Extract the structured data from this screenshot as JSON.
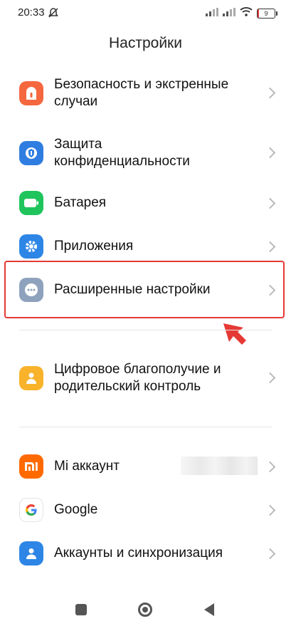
{
  "status": {
    "time": "20:33",
    "battery_level": "9",
    "battery_fraction": 0.09
  },
  "header": {
    "title": "Настройки"
  },
  "items": [
    {
      "label_lines": [
        "Безопасность и экстренные",
        "случаи"
      ],
      "icon": "shield-icon",
      "color": "#f5683f"
    },
    {
      "label_lines": [
        "Защита",
        "конфиденциальности"
      ],
      "icon": "privacy-icon",
      "color": "#2f7de0"
    },
    {
      "label_lines": [
        "Батарея"
      ],
      "icon": "battery-icon",
      "color": "#1fc55c"
    },
    {
      "label_lines": [
        "Приложения"
      ],
      "icon": "gear-icon",
      "color": "#2d86e6"
    },
    {
      "label_lines": [
        "Расширенные настройки"
      ],
      "icon": "more-icon",
      "color": "#8fa2bd"
    },
    {
      "label_lines": [
        "Цифровое благополучие и",
        "родительский контроль"
      ],
      "icon": "wellbeing-icon",
      "color": "#f8b32b"
    },
    {
      "label_lines": [
        "Mi аккаунт"
      ],
      "icon": "mi-icon",
      "color": "#ff6a00"
    },
    {
      "label_lines": [
        "Google"
      ],
      "icon": "google-icon",
      "color": "#ffffff"
    },
    {
      "label_lines": [
        "Аккаунты и синхронизация"
      ],
      "icon": "account-icon",
      "color": "#2d86e6"
    }
  ],
  "annotation": {
    "highlight_color": "#e53935"
  }
}
